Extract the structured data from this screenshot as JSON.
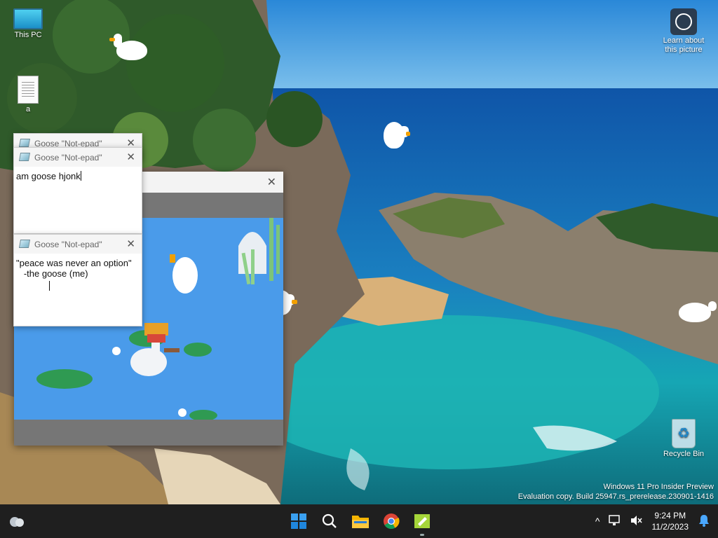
{
  "desktop": {
    "icons": [
      {
        "label": "This PC",
        "icon": "monitor-icon"
      },
      {
        "label": "a",
        "icon": "text-file-icon"
      },
      {
        "label": "Learn about this picture",
        "icon": "camera-info-icon"
      },
      {
        "label": "Recycle Bin",
        "icon": "recycle-bin-icon"
      }
    ],
    "watermark": {
      "line1": "Windows 11 Pro Insider Preview",
      "line2": "Evaluation copy. Build 25947.rs_prerelease.230901-1416"
    }
  },
  "windows": {
    "notepad_back": {
      "title": "Goose \"Not-epad\""
    },
    "notepad_top": {
      "title": "Goose \"Not-epad\"",
      "text": "am goose hjonk"
    },
    "notepad_quote": {
      "title": "Goose \"Not-epad\"",
      "text": "\"peace was never an option\"\n   -the goose (me)"
    },
    "game": {
      "close_glyph": "✕"
    }
  },
  "taskbar": {
    "apps": [
      {
        "name": "Start",
        "icon": "windows-logo-icon"
      },
      {
        "name": "Search",
        "icon": "search-icon"
      },
      {
        "name": "File Explorer",
        "icon": "folder-icon"
      },
      {
        "name": "Chrome",
        "icon": "chrome-icon"
      },
      {
        "name": "Goose Notepad",
        "icon": "notepad-icon"
      }
    ],
    "tray": {
      "chevron": "^",
      "time": "9:24 PM",
      "date": "11/2/2023"
    }
  },
  "colors": {
    "taskbar": "#1f1f1f",
    "windows_blue": "#0078d4",
    "game_water": "#4a9bea"
  }
}
